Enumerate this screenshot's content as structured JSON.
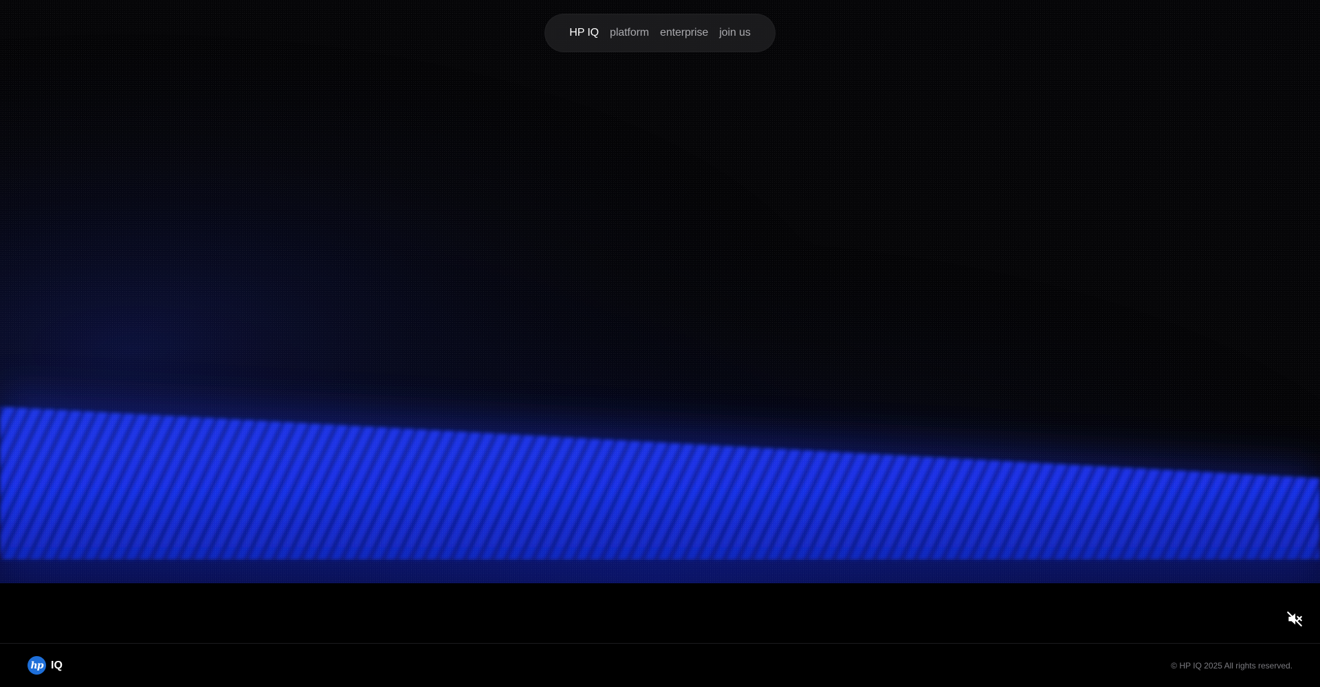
{
  "nav": {
    "items": [
      {
        "label": "HP IQ",
        "active": true
      },
      {
        "label": "platform",
        "active": false
      },
      {
        "label": "enterprise",
        "active": false
      },
      {
        "label": "join us",
        "active": false
      }
    ]
  },
  "hero": {
    "ghost_text": "",
    "accent_color": "#1e3cff"
  },
  "media": {
    "mute_icon": "speaker-muted-icon"
  },
  "footer": {
    "logo_mark": "hp",
    "brand_suffix": "IQ",
    "copyright": "© HP IQ 2025 All rights reserved."
  }
}
